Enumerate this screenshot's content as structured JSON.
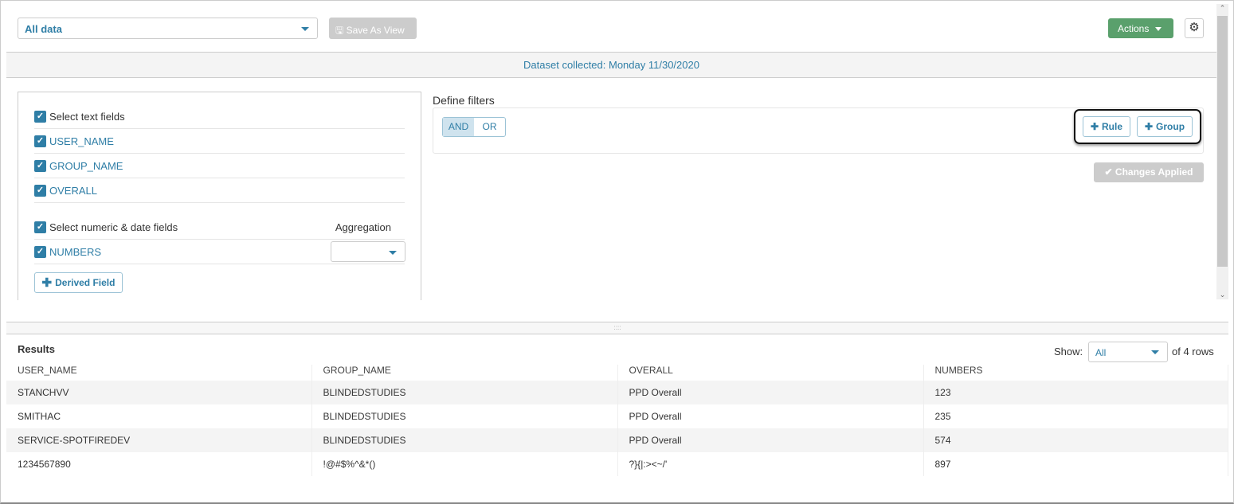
{
  "toolbar": {
    "view_select": "All data",
    "save_as_view": "Save As View",
    "actions": "Actions",
    "settings_icon": "gear-icon"
  },
  "banner": "Dataset collected: Monday 11/30/2020",
  "fields": {
    "text_header": "Select text fields",
    "text_fields": [
      "USER_NAME",
      "GROUP_NAME",
      "OVERALL"
    ],
    "numeric_header": "Select numeric & date fields",
    "aggregation_label": "Aggregation",
    "numeric_fields": [
      "NUMBERS"
    ],
    "derived_field": "Derived Field"
  },
  "filters": {
    "title": "Define filters",
    "and": "AND",
    "or": "OR",
    "rule": "Rule",
    "group": "Group",
    "changes_applied": "Changes Applied"
  },
  "results": {
    "title": "Results",
    "show_label": "Show:",
    "show_value": "All",
    "rows_suffix": "of 4 rows",
    "columns": [
      "USER_NAME",
      "GROUP_NAME",
      "OVERALL",
      "NUMBERS"
    ],
    "rows": [
      [
        "STANCHVV",
        "BLINDEDSTUDIES",
        "PPD Overall",
        "123"
      ],
      [
        "SMITHAC",
        "BLINDEDSTUDIES",
        "PPD Overall",
        "235"
      ],
      [
        "SERVICE-SPOTFIREDEV",
        "BLINDEDSTUDIES",
        "PPD Overall",
        "574"
      ],
      [
        "1234567890",
        "!@#$%^&*()",
        "?}{|:><~/'",
        "897"
      ]
    ]
  }
}
